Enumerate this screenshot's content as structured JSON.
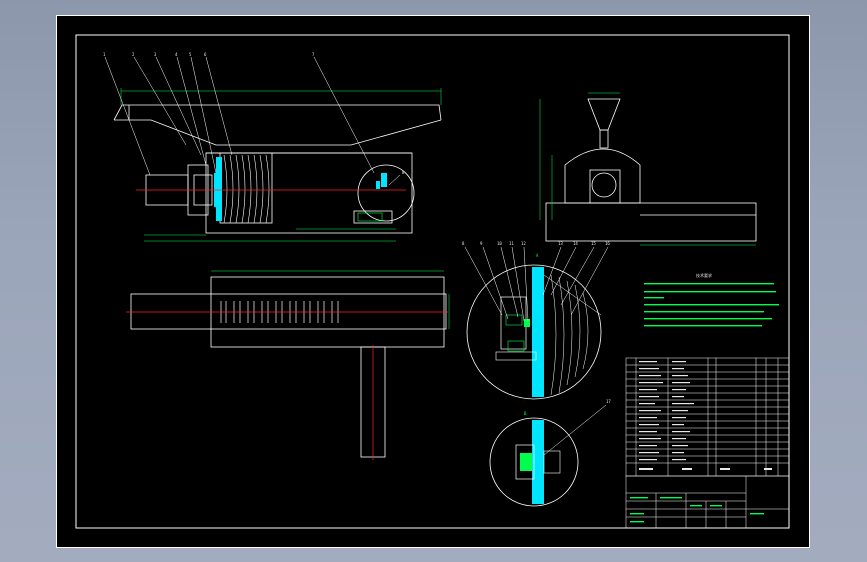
{
  "app": {
    "background_gradient": [
      "#8d97ac",
      "#a3acbf"
    ],
    "canvas_bg": "#000000"
  },
  "colors": {
    "outline": "#ffffff",
    "dimension": "#00ff4c",
    "center_line": "#ff2020",
    "section_fill": "#00e5ff",
    "hatch": "#ffffff"
  },
  "drawing": {
    "balloons_top": [
      "1",
      "2",
      "3",
      "4",
      "5",
      "6",
      "7"
    ],
    "balloon_right_detail": "8",
    "balloons_section": [
      "8",
      "9",
      "10",
      "11",
      "12",
      "13",
      "14",
      "15",
      "16"
    ],
    "balloon_detail_b": "17",
    "section_label_a": "A",
    "section_label_b": "B",
    "notes_title": "技术要求"
  }
}
